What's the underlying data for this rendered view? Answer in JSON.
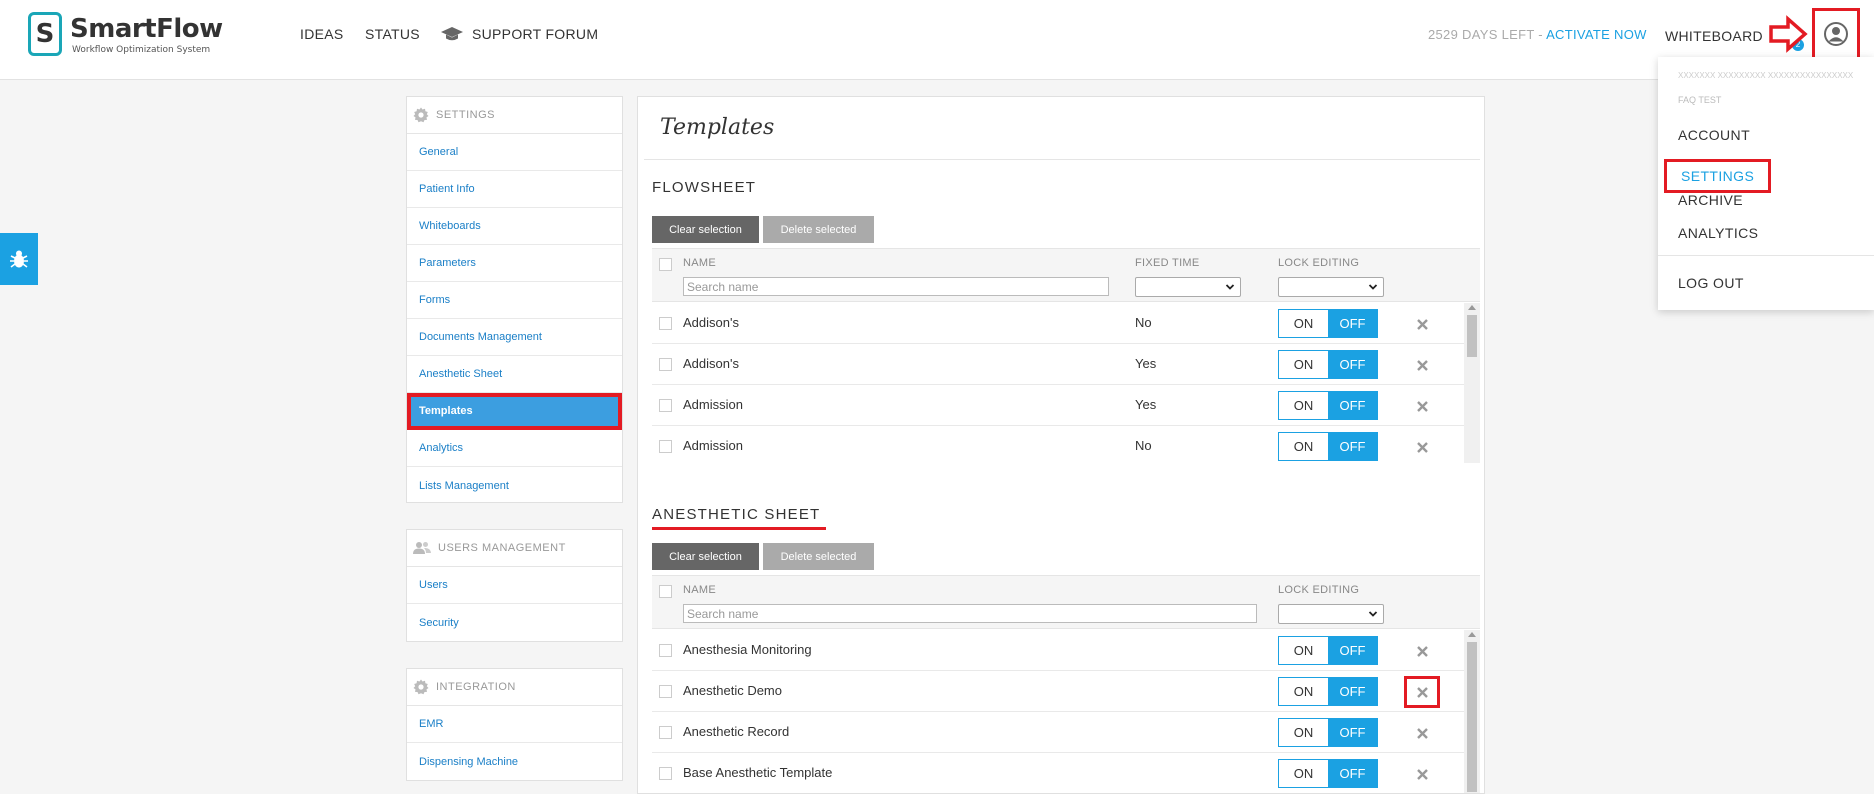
{
  "header": {
    "logo_text": "SmartFlow",
    "logo_sub": "Workflow Optimization System",
    "nav": [
      "IDEAS",
      "STATUS",
      "SUPPORT FORUM"
    ],
    "days_left": "2529 DAYS LEFT - ",
    "activate": "ACTIVATE NOW",
    "whiteboard": "WHITEBOARD",
    "wb_badge": "2"
  },
  "dropdown": {
    "faded_user": "XXXXXXX XXXXXXXXX XXXXXXXXXXXXXXXX",
    "faded_line": "FAQ TEST",
    "items": [
      "ACCOUNT",
      "SETTINGS",
      "ARCHIVE",
      "ANALYTICS"
    ],
    "logout": "LOG OUT"
  },
  "sidebar": {
    "settings": {
      "title": "SETTINGS",
      "items": [
        "General",
        "Patient Info",
        "Whiteboards",
        "Parameters",
        "Forms",
        "Documents Management",
        "Anesthetic Sheet",
        "Templates",
        "Analytics",
        "Lists Management"
      ]
    },
    "users": {
      "title": "USERS MANAGEMENT",
      "items": [
        "Users",
        "Security"
      ]
    },
    "integration": {
      "title": "INTEGRATION",
      "items": [
        "EMR",
        "Dispensing Machine"
      ]
    }
  },
  "main": {
    "title": "Templates",
    "clear_label": "Clear selection",
    "delete_label": "Delete selected",
    "search_placeholder": "Search name",
    "toggle_on": "ON",
    "toggle_off": "OFF",
    "flowsheet": {
      "title": "FLOWSHEET",
      "columns": [
        "NAME",
        "FIXED TIME",
        "LOCK EDITING"
      ],
      "rows": [
        {
          "name": "Addison's",
          "fixed": "No"
        },
        {
          "name": "Addison's",
          "fixed": "Yes"
        },
        {
          "name": "Admission",
          "fixed": "Yes"
        },
        {
          "name": "Admission",
          "fixed": "No"
        }
      ]
    },
    "anesthetic": {
      "title": "ANESTHETIC SHEET",
      "columns": [
        "NAME",
        "LOCK EDITING"
      ],
      "rows": [
        {
          "name": "Anesthesia Monitoring"
        },
        {
          "name": "Anesthetic Demo"
        },
        {
          "name": "Anesthetic Record"
        },
        {
          "name": "Base Anesthetic Template"
        }
      ]
    }
  },
  "colors": {
    "accent": "#1ba1e2",
    "highlight": "#e31b23",
    "active_item": "#3c9ee0"
  }
}
